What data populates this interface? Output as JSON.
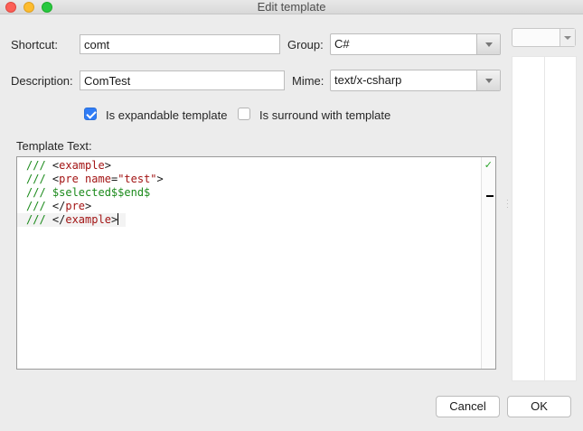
{
  "window": {
    "title": "Edit template"
  },
  "form": {
    "shortcut_label": "Shortcut:",
    "shortcut_value": "comt",
    "group_label": "Group:",
    "group_value": "C#",
    "description_label": "Description:",
    "description_value": "ComTest",
    "mime_label": "Mime:",
    "mime_value": "text/x-csharp",
    "expandable_label": "Is expandable template",
    "expandable_checked": true,
    "surround_label": "Is surround with template",
    "surround_checked": false,
    "template_text_label": "Template Text:"
  },
  "editor": {
    "lines": [
      [
        {
          "t": "/// ",
          "c": "green"
        },
        {
          "t": "<",
          "c": "dark"
        },
        {
          "t": "example",
          "c": "red"
        },
        {
          "t": ">",
          "c": "dark"
        }
      ],
      [
        {
          "t": "/// ",
          "c": "green"
        },
        {
          "t": "<",
          "c": "dark"
        },
        {
          "t": "pre",
          "c": "red"
        },
        {
          "t": " name",
          "c": "red"
        },
        {
          "t": "=",
          "c": "dark"
        },
        {
          "t": "\"test\"",
          "c": "str"
        },
        {
          "t": ">",
          "c": "dark"
        }
      ],
      [
        {
          "t": "/// ",
          "c": "green"
        },
        {
          "t": "$selected$$end$",
          "c": "green"
        }
      ],
      [
        {
          "t": "/// ",
          "c": "green"
        },
        {
          "t": "</",
          "c": "dark"
        },
        {
          "t": "pre",
          "c": "red"
        },
        {
          "t": ">",
          "c": "dark"
        }
      ],
      [
        {
          "t": "/// ",
          "c": "green"
        },
        {
          "t": "</",
          "c": "dark"
        },
        {
          "t": "example",
          "c": "red"
        },
        {
          "t": ">",
          "c": "dark"
        }
      ]
    ],
    "current_line_index": 4
  },
  "buttons": {
    "cancel_label": "Cancel",
    "ok_label": "OK"
  },
  "icons": {
    "valid_check": "✓"
  }
}
